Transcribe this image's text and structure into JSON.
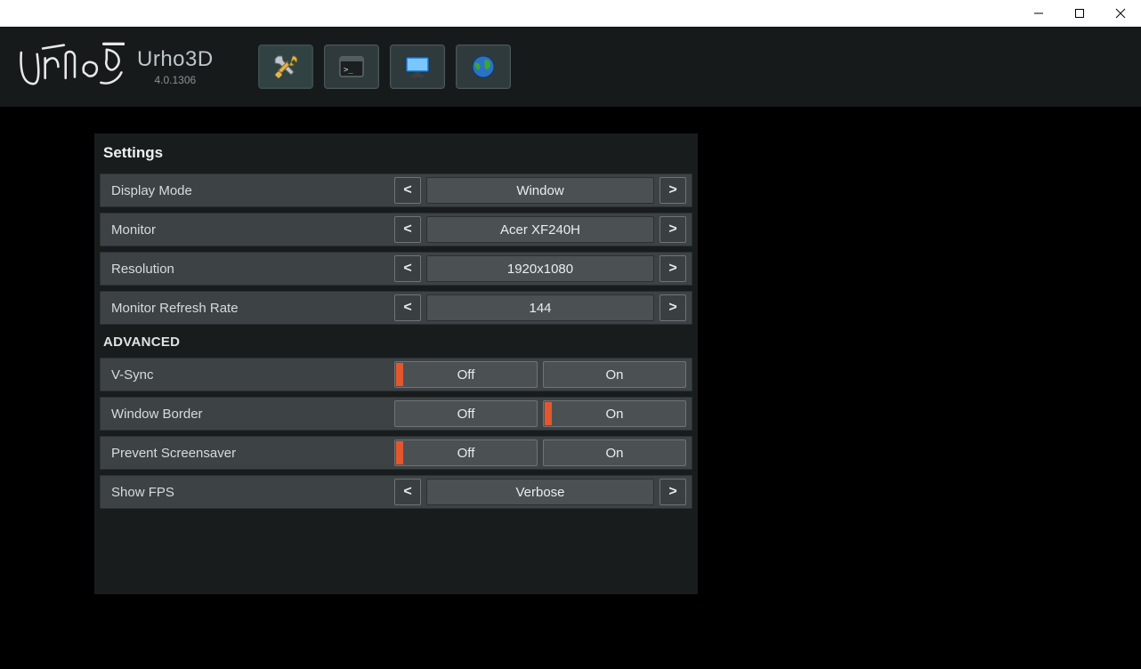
{
  "app": {
    "title": "Urho3D",
    "version": "4.0.1306"
  },
  "tabs": {
    "settings_icon": "settings",
    "terminal_icon": "terminal",
    "display_icon": "display",
    "globe_icon": "globe"
  },
  "panel": {
    "title": "Settings",
    "advanced_title": "ADVANCED",
    "arrow_prev": "<",
    "arrow_next": ">",
    "rows": {
      "display_mode": {
        "label": "Display Mode",
        "value": "Window"
      },
      "monitor": {
        "label": "Monitor",
        "value": "Acer XF240H"
      },
      "resolution": {
        "label": "Resolution",
        "value": "1920x1080"
      },
      "refresh_rate": {
        "label": "Monitor Refresh Rate",
        "value": "144"
      },
      "vsync": {
        "label": "V-Sync",
        "off": "Off",
        "on": "On",
        "selected": "off"
      },
      "window_border": {
        "label": "Window Border",
        "off": "Off",
        "on": "On",
        "selected": "on"
      },
      "prevent_screensaver": {
        "label": "Prevent Screensaver",
        "off": "Off",
        "on": "On",
        "selected": "off"
      },
      "show_fps": {
        "label": "Show FPS",
        "value": "Verbose"
      }
    }
  }
}
